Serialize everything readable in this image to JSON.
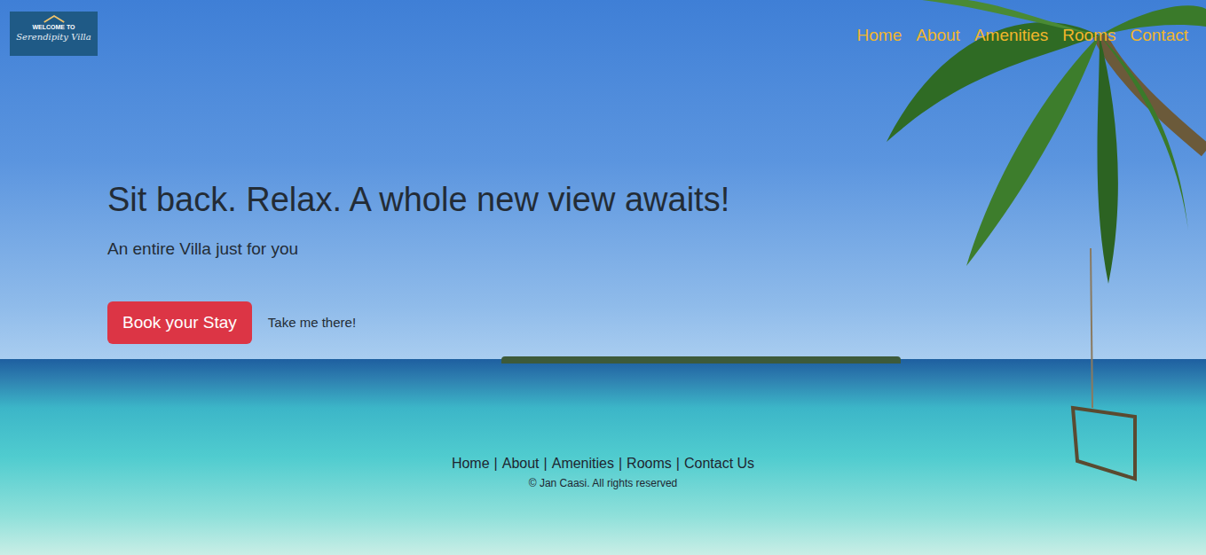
{
  "logo": {
    "line1": "WELCOME TO",
    "line2": "Serendipity Villa"
  },
  "nav": [
    {
      "label": "Home"
    },
    {
      "label": "About"
    },
    {
      "label": "Amenities"
    },
    {
      "label": "Rooms"
    },
    {
      "label": "Contact"
    }
  ],
  "hero": {
    "title": "Sit back. Relax. A whole new view awaits!",
    "subtitle": "An entire Villa just for you",
    "primary_button": "Book your Stay",
    "secondary_link": "Take me there!"
  },
  "footer": {
    "links": [
      "Home",
      "About",
      "Amenities",
      "Rooms",
      "Contact Us"
    ],
    "separator": "|",
    "copyright": "© Jan Caasi. All rights reserved"
  }
}
